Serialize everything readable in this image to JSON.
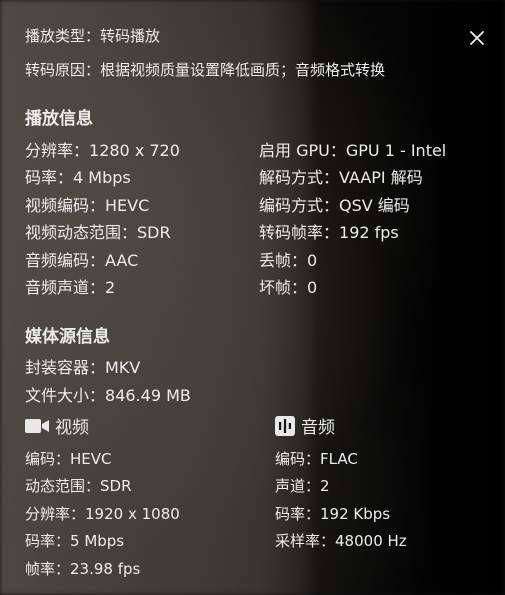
{
  "header": {
    "play_type_label": "播放类型：",
    "play_type_value": "转码播放",
    "reason_label": "转码原因：",
    "reason_value": "根据视频质量设置降低画质；音频格式转换"
  },
  "playback": {
    "title": "播放信息",
    "left": [
      {
        "label": "分辨率：",
        "value": "1280 x 720"
      },
      {
        "label": "码率：",
        "value": "4 Mbps"
      },
      {
        "label": "视频编码：",
        "value": "HEVC"
      },
      {
        "label": "视频动态范围：",
        "value": "SDR"
      },
      {
        "label": "音频编码：",
        "value": "AAC"
      },
      {
        "label": "音频声道：",
        "value": "2"
      }
    ],
    "right": [
      {
        "label": "启用 GPU：",
        "value": "GPU 1 - Intel"
      },
      {
        "label": "解码方式：",
        "value": "VAAPI 解码"
      },
      {
        "label": "编码方式：",
        "value": "QSV 编码"
      },
      {
        "label": "转码帧率：",
        "value": "192 fps"
      },
      {
        "label": "丢帧：",
        "value": "0"
      },
      {
        "label": "坏帧：",
        "value": "0"
      }
    ]
  },
  "media": {
    "title": "媒体源信息",
    "rows": [
      {
        "label": "封装容器：",
        "value": "MKV"
      },
      {
        "label": "文件大小：",
        "value": "846.49 MB"
      }
    ],
    "video": {
      "title": "视频",
      "icon": "video-camera-icon",
      "rows": [
        {
          "label": "编码：",
          "value": "HEVC"
        },
        {
          "label": "动态范围：",
          "value": "SDR"
        },
        {
          "label": "分辨率：",
          "value": "1920 x 1080"
        },
        {
          "label": "码率：",
          "value": "5 Mbps"
        },
        {
          "label": "帧率：",
          "value": "23.98 fps"
        }
      ]
    },
    "audio": {
      "title": "音频",
      "icon": "audio-wave-icon",
      "rows": [
        {
          "label": "编码：",
          "value": "FLAC"
        },
        {
          "label": "声道：",
          "value": "2"
        },
        {
          "label": "码率：",
          "value": "192 Kbps"
        },
        {
          "label": "采样率：",
          "value": "48000 Hz"
        }
      ]
    }
  },
  "close_icon": "close-icon"
}
